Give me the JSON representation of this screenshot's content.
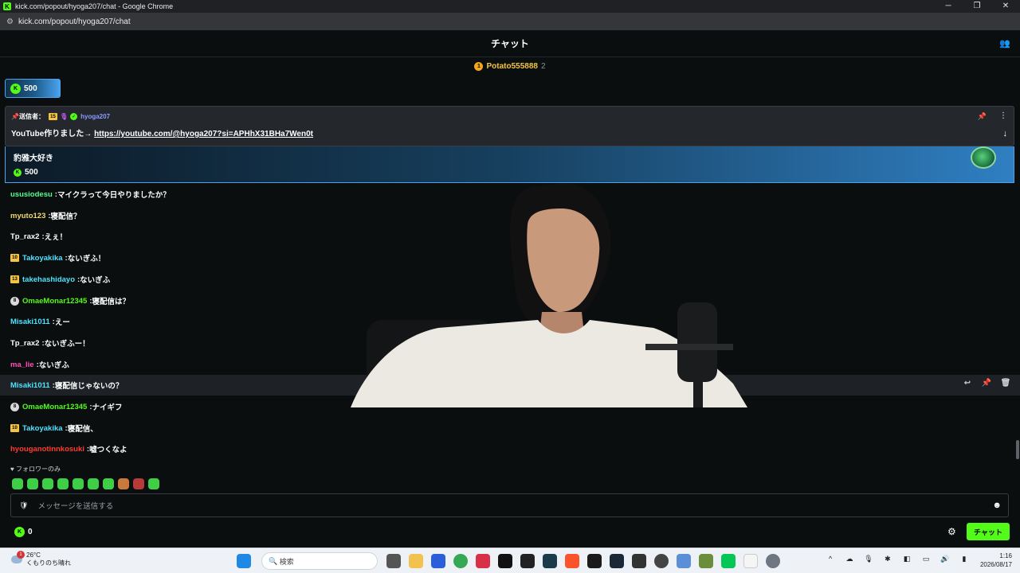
{
  "window": {
    "title": "kick.com/popout/hyoga207/chat - Google Chrome",
    "url": "kick.com/popout/hyoga207/chat",
    "controls": [
      "─",
      "❐",
      "✕"
    ]
  },
  "header": {
    "title": "チャット"
  },
  "top_gifter": {
    "rank": "1",
    "name": "Potato555888",
    "count": "2"
  },
  "kicks_button": {
    "amount": "500"
  },
  "pinned": {
    "label": "送信者：",
    "badge": "15",
    "username": "hyoga207",
    "message_prefix": "YouTube作りました→ ",
    "link": "https://youtube.com/@hyoga207?si=APHhX31BHa7Wen0t"
  },
  "kicks_card": {
    "message": "豹雅大好き",
    "amount": "500"
  },
  "messages": [
    {
      "badge": "",
      "badge_type": "",
      "user": "ususiodesu",
      "color": "#53fc8e",
      "text": "マイクラって今日やりましたか？"
    },
    {
      "badge": "",
      "badge_type": "",
      "user": "myuto123",
      "color": "#f2d96b",
      "text": "寝配信？"
    },
    {
      "badge": "",
      "badge_type": "",
      "user": "Tp_rax2",
      "color": "#ffffff",
      "text": "えぇ！"
    },
    {
      "badge": "10",
      "badge_type": "sub",
      "user": "Takoyakika",
      "color": "#4de3ff",
      "text": "ないぎふ！"
    },
    {
      "badge": "13",
      "badge_type": "sub",
      "user": "takehashidayo",
      "color": "#4de3ff",
      "text": "ないぎふ"
    },
    {
      "badge": "8",
      "badge_type": "round",
      "user": "OmaeMonar12345",
      "color": "#53fc18",
      "text": "寝配信は？"
    },
    {
      "badge": "",
      "badge_type": "",
      "user": "Misaki1011",
      "color": "#4de3ff",
      "text": "えー"
    },
    {
      "badge": "",
      "badge_type": "",
      "user": "Tp_rax2",
      "color": "#ffffff",
      "text": "ないぎふー！"
    },
    {
      "badge": "",
      "badge_type": "",
      "user": "ma_lie",
      "color": "#ff4fb8",
      "text": "ないぎふ"
    },
    {
      "badge": "",
      "badge_type": "",
      "user": "Misaki1011",
      "color": "#4de3ff",
      "text": "寝配信じゃないの？"
    },
    {
      "badge": "8",
      "badge_type": "round",
      "user": "OmaeMonar12345",
      "color": "#53fc18",
      "text": "ナイギフ"
    },
    {
      "badge": "10",
      "badge_type": "sub",
      "user": "Takoyakika",
      "color": "#4de3ff",
      "text": "寝配信、"
    },
    {
      "badge": "",
      "badge_type": "",
      "user": "hyouganotinnkosuki",
      "color": "#ff3b30",
      "text": "嘘つくなよ"
    }
  ],
  "followers_only": "フォロワーのみ",
  "input": {
    "placeholder": "メッセージを送信する"
  },
  "footer": {
    "balance": "0",
    "send_label": "チャット"
  },
  "taskbar": {
    "temperature": "26°C",
    "weather": "くもりのち晴れ",
    "alert_count": "1",
    "search_placeholder": "検索",
    "time": "1:16",
    "date": "2026/08/17"
  }
}
